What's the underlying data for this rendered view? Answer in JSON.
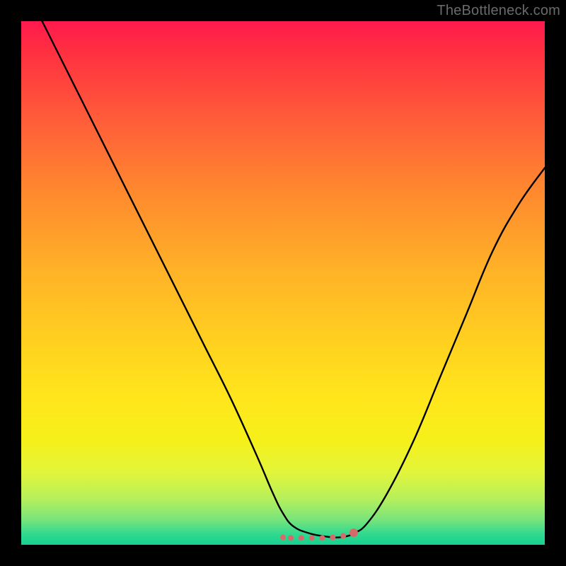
{
  "attribution": "TheBottleneck.com",
  "chart_data": {
    "type": "line",
    "title": "",
    "xlabel": "",
    "ylabel": "",
    "xlim": [
      0,
      100
    ],
    "ylim": [
      0,
      100
    ],
    "grid": false,
    "series": [
      {
        "name": "curve",
        "color": "#000000",
        "x": [
          4,
          10,
          15,
          20,
          25,
          30,
          35,
          40,
          45,
          48,
          50,
          52,
          55,
          58,
          60,
          62,
          63.5,
          66,
          70,
          75,
          80,
          85,
          90,
          95,
          100
        ],
        "y": [
          100,
          88,
          78,
          68,
          58,
          48,
          38,
          28,
          17,
          10,
          6,
          3.5,
          2.2,
          1.6,
          1.4,
          1.6,
          2.2,
          4,
          10,
          20,
          32,
          44,
          56,
          65,
          72
        ]
      }
    ],
    "valley_markers": {
      "color": "#d66a6a",
      "radius_small": 4,
      "radius_end": 6,
      "points_x": [
        50,
        51.5,
        53.5,
        55.5,
        57.5,
        59.5,
        61.5,
        63.5
      ],
      "points_y": [
        1.4,
        1.3,
        1.3,
        1.3,
        1.3,
        1.4,
        1.7,
        2.3
      ]
    },
    "background_gradient": {
      "top": "#ff1a4d",
      "mid": "#ffd21f",
      "bottom": "#18d18f"
    }
  }
}
